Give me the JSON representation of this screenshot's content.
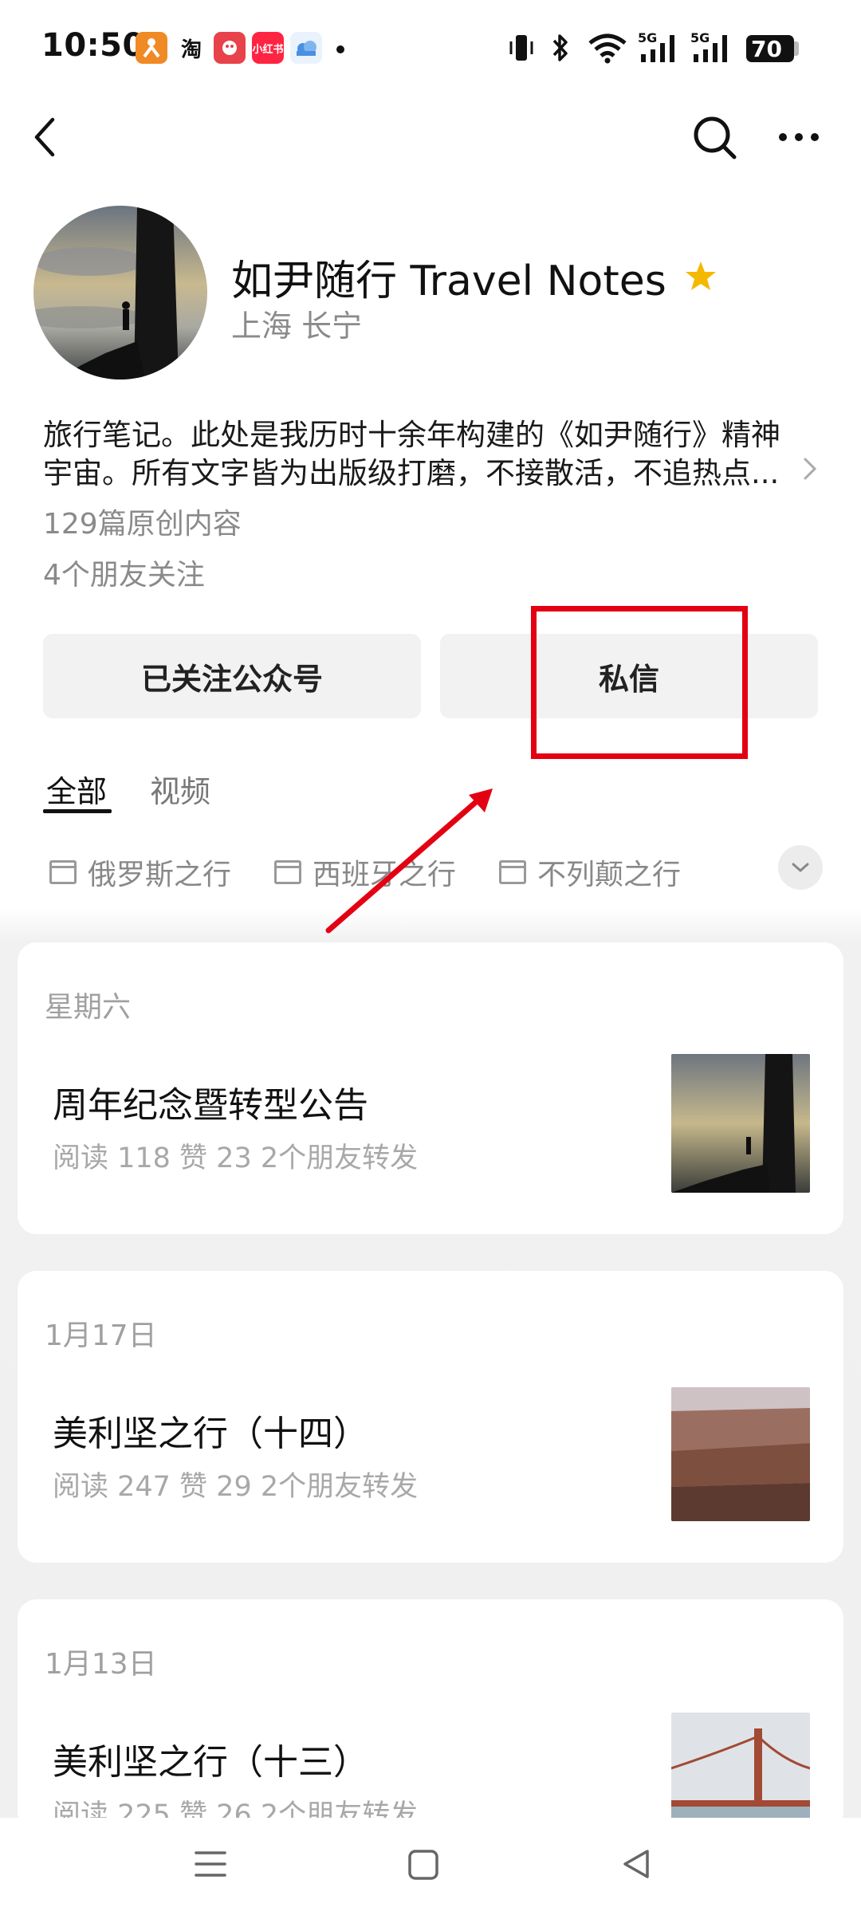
{
  "status_bar": {
    "time": "10:50",
    "apps": [
      {
        "name": "meituan",
        "label": "",
        "color": "#f08a24"
      },
      {
        "name": "taobao",
        "label": "淘",
        "color": "#ffffff"
      },
      {
        "name": "game",
        "label": "",
        "color": "#e8424a"
      },
      {
        "name": "xiaohongshu",
        "label": "小红书",
        "color": "#ff2442"
      },
      {
        "name": "cloud-app",
        "label": "",
        "color": "#4a90e2"
      }
    ],
    "network1": "5G",
    "network2": "5G",
    "battery": "70"
  },
  "header": {
    "back_icon": "chevron-left-icon",
    "search_icon": "search-icon",
    "more_icon": "more-icon"
  },
  "profile": {
    "name": "如尹随行 Travel Notes",
    "location": "上海 长宁",
    "bio_line1": "旅行笔记。此处是我历时十余年构建的《如尹随行》精神",
    "bio_line2": "宇宙。所有文字皆为出版级打磨，不接散活，不追热点...",
    "original_count": "129篇原创内容",
    "friends_following": "4个朋友关注"
  },
  "actions": {
    "follow_label": "已关注公众号",
    "message_label": "私信"
  },
  "annotation": {
    "color": "#e30012"
  },
  "tabs": [
    {
      "label": "全部",
      "active": true
    },
    {
      "label": "视频",
      "active": false
    }
  ],
  "collections": [
    "俄罗斯之行",
    "西班牙之行",
    "不列颠之行"
  ],
  "articles": [
    {
      "date": "星期六",
      "title": "周年纪念暨转型公告",
      "stats": "阅读 118   赞 23   2个朋友转发"
    },
    {
      "date": "1月17日",
      "title": "美利坚之行（十四）",
      "stats": "阅读 247   赞 29   2个朋友转发"
    },
    {
      "date": "1月13日",
      "title": "美利坚之行（十三）",
      "stats": "阅读 225   赞 26   2个朋友转发"
    }
  ]
}
